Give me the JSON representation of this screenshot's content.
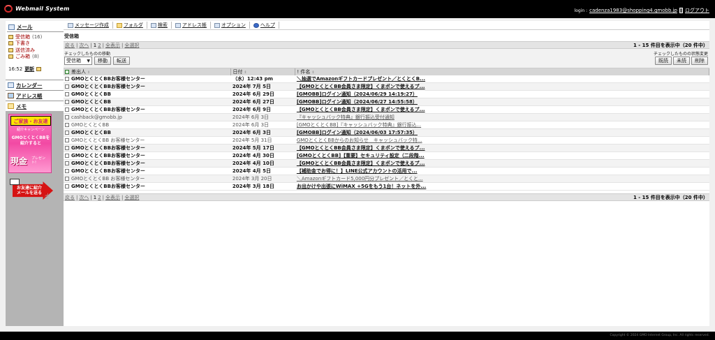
{
  "header": {
    "app_title": "Webmail System",
    "login_label": "login :",
    "login_email": "cadenza1983@shopping4.gmobb.jp",
    "logout_label": "ログアウト"
  },
  "sidebar": {
    "mail_label": "メール",
    "folders": [
      {
        "name": "受信箱",
        "count": "(16)"
      },
      {
        "name": "下書き",
        "count": ""
      },
      {
        "name": "送信済み",
        "count": ""
      },
      {
        "name": "ごみ箱",
        "count": "(8)"
      }
    ],
    "time": "16:52",
    "refresh_label": "更新",
    "calendar_label": "カレンダー",
    "addressbook_label": "アドレス帳",
    "memo_label": "メモ",
    "banner": {
      "head": "ご家族・お友達",
      "sub": "紹介キャンペーン",
      "mid": "GMOとくとくBBを紹介すると",
      "big": "現金",
      "small": "プレゼント!"
    },
    "invite_label_1": "お友達に紹介",
    "invite_label_2": "メールを送る"
  },
  "toolbar": {
    "items": [
      {
        "label": "メッセージ作成",
        "icon": "compose-icon"
      },
      {
        "label": "フォルダ",
        "icon": "folder-icon"
      },
      {
        "label": "検索",
        "icon": "search-icon"
      },
      {
        "label": "アドレス帳",
        "icon": "addressbook-icon"
      },
      {
        "label": "オプション",
        "icon": "options-icon"
      },
      {
        "label": "ヘルプ",
        "icon": "help-icon"
      }
    ]
  },
  "main": {
    "folder_title": "受信箱",
    "pager": {
      "back": "戻る",
      "next": "次へ",
      "page1": "1",
      "page2": "2",
      "show_all": "全表示",
      "select_all": "全選択",
      "summary": "1 - 15 件目を表示中（20 件中）"
    },
    "move_label": "チェックしたものの移動",
    "state_label": "チェックしたものの状態変更",
    "move_target": "受信箱",
    "move_button": "移動",
    "forward_button": "転送",
    "read_button": "既読",
    "unread_button": "未読",
    "delete_button": "削除",
    "columns": {
      "sender": "差出人",
      "date": "日付",
      "subject": "件名"
    },
    "messages": [
      {
        "sender": "GMOとくとくBBお客様センター",
        "date": "（水）12:43 pm",
        "subject": "＼抽選でAmazonギフトカードプレゼント／とくとくB...",
        "unread": true
      },
      {
        "sender": "GMOとくとくBBお客様センター",
        "date": "2024年 7月 5日",
        "subject": "【GMOとくとくBB会員さま限定】くまポンで使えるプ...",
        "unread": true
      },
      {
        "sender": "GMOとくとくBB",
        "date": "2024年 6月 29日",
        "subject": "[GMOBB]ログイン通知（2024/06/29 14:19:27）",
        "unread": true
      },
      {
        "sender": "GMOとくとくBB",
        "date": "2024年 6月 27日",
        "subject": "[GMOBB]ログイン通知（2024/06/27 14:55:58）",
        "unread": true
      },
      {
        "sender": "GMOとくとくBBお客様センター",
        "date": "2024年 6月 9日",
        "subject": "【GMOとくとくBB会員さま限定】くまポンで使えるプ...",
        "unread": true
      },
      {
        "sender": "cashback@gmobb.jp",
        "date": "2024年 6月 3日",
        "subject": "『キャッシュバック特典』銀行振込受付通知",
        "unread": false
      },
      {
        "sender": "GMOとくとくBB",
        "date": "2024年 6月 3日",
        "subject": "[GMOとくとくBB]『キャッシュバック特典』銀行振込...",
        "unread": false
      },
      {
        "sender": "GMOとくとくBB",
        "date": "2024年 6月 3日",
        "subject": "[GMOBB]ログイン通知（2024/06/03 17:57:35）",
        "unread": true
      },
      {
        "sender": "GMOとくとくBB お客様センター",
        "date": "2024年 5月 31日",
        "subject": "GMOとくとくBBからのお知らせ　キャッシュバック特...",
        "unread": false
      },
      {
        "sender": "GMOとくとくBBお客様センター",
        "date": "2024年 5月 17日",
        "subject": "【GMOとくとくBB会員さま限定】くまポンで使えるプ...",
        "unread": true
      },
      {
        "sender": "GMOとくとくBBお客様センター",
        "date": "2024年 4月 30日",
        "subject": "[GMOとくとくBB]【重要】セキュリティ設定（二段階...",
        "unread": true
      },
      {
        "sender": "GMOとくとくBBお客様センター",
        "date": "2024年 4月 10日",
        "subject": "【GMOとくとくBB会員さま限定】くまポンで使えるプ...",
        "unread": true
      },
      {
        "sender": "GMOとくとくBBお客様センター",
        "date": "2024年 4月 5日",
        "subject": "【補助金でお得に！】LINE公式アカウントの活用で...",
        "unread": true
      },
      {
        "sender": "GMOとくとくBB お客様センター",
        "date": "2024年 3月 20日",
        "subject": "＼Amazonギフトカード5,000円分プレゼント／とくと...",
        "unread": false
      },
      {
        "sender": "GMOとくとくBBお客様センター",
        "date": "2024年 3月 18日",
        "subject": "お出かけや出張にWiMAX +5Gをもう1台！ネットを外...",
        "unread": true
      }
    ]
  },
  "footer": {
    "copyright": "Copyright © 2024 GMO Internet Group, Inc. All rights reserved."
  }
}
